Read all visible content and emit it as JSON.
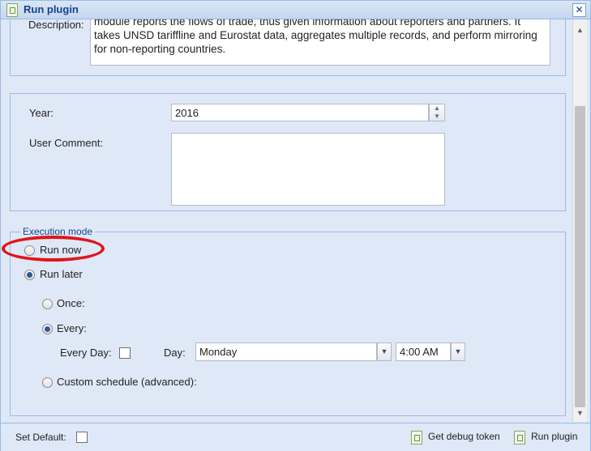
{
  "window": {
    "title": "Run plugin",
    "close_glyph": "✕"
  },
  "description": {
    "label": "Description:",
    "text": "module reports the flows of trade, thus given information about reporters and partners. It takes UNSD tariffline and Eurostat data, aggregates multiple records, and perform mirroring for non-reporting countries."
  },
  "params": {
    "year_label": "Year:",
    "year_value": "2016",
    "comment_label": "User Comment:",
    "comment_value": ""
  },
  "execution": {
    "legend": "Execution mode",
    "run_now_label": "Run now",
    "run_later_label": "Run later",
    "selected_mode": "run_later",
    "once_label": "Once:",
    "every_label": "Every:",
    "every_day_label": "Every Day:",
    "day_label": "Day:",
    "day_value": "Monday",
    "time_value": "4:00 AM",
    "custom_label": "Custom schedule (advanced):"
  },
  "footer": {
    "set_default_label": "Set Default:",
    "debug_button": "Get debug token",
    "run_button": "Run plugin"
  },
  "icons": {
    "up": "▲",
    "down": "▼",
    "combo": "▼"
  }
}
